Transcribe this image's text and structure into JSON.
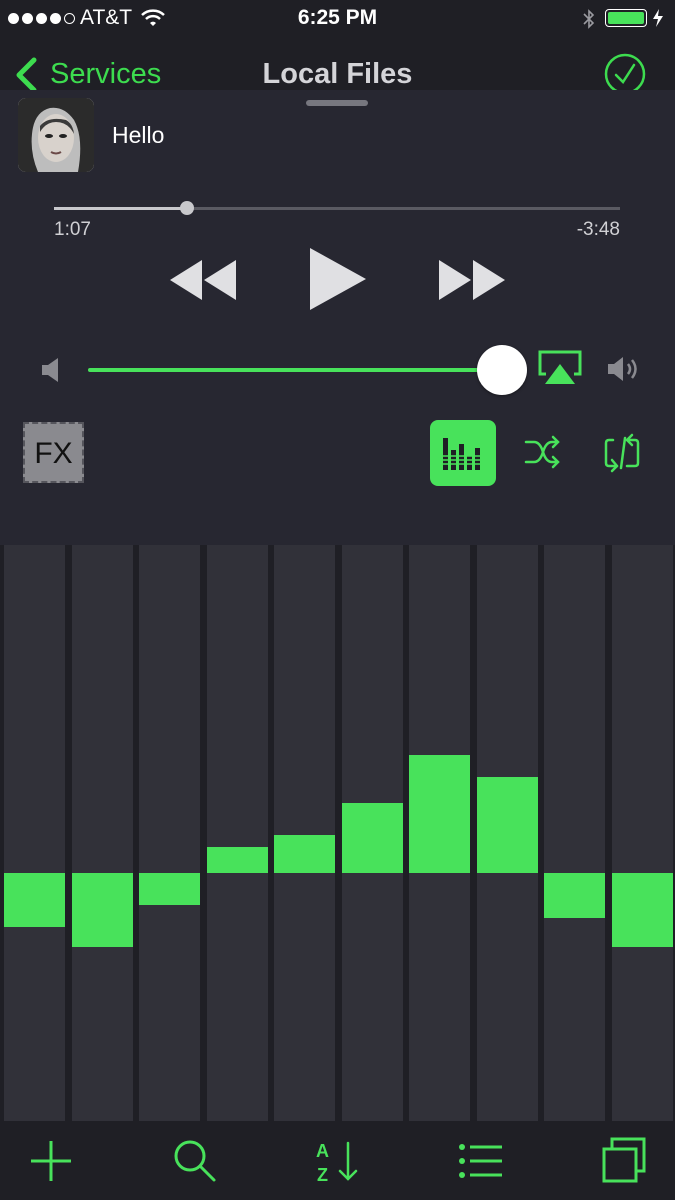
{
  "status_bar": {
    "carrier": "AT&T",
    "time": "6:25 PM"
  },
  "nav": {
    "back_label": "Services",
    "title": "Local Files"
  },
  "now_playing": {
    "title": "Hello",
    "elapsed": "1:07",
    "remaining": "-3:48",
    "progress": 0.235,
    "volume": 0.99
  },
  "controls": {
    "fx_label": "FX"
  },
  "equalizer": {
    "bands": [
      -0.17,
      -0.23,
      -0.1,
      0.08,
      0.12,
      0.22,
      0.37,
      0.3,
      -0.14,
      -0.23
    ]
  },
  "colors": {
    "accent": "#48e25b",
    "background": "#1f1f25",
    "panel": "#272731",
    "band": "#313139"
  }
}
